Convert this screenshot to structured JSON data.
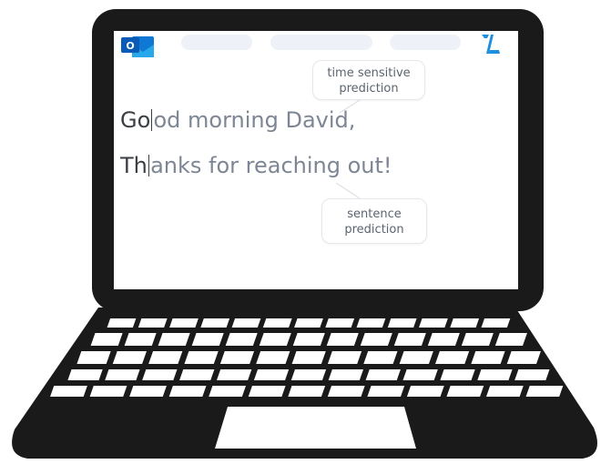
{
  "app": {
    "icon_name": "outlook-icon",
    "icon_letter": "O",
    "brand_logo_name": "typewise-logo-icon",
    "brand_color": "#1d8fdc"
  },
  "toolbar": {
    "pill_count": 3
  },
  "composer": {
    "line1": {
      "typed": "Go",
      "predicted": "od morning David,"
    },
    "line2": {
      "typed": "Th",
      "predicted": "anks for reaching out!"
    }
  },
  "callouts": {
    "time_sensitive": {
      "line1": "time sensitive",
      "line2": "prediction"
    },
    "sentence": {
      "line1": "sentence",
      "line2": "prediction"
    }
  },
  "colors": {
    "typed_text": "#3b3f45",
    "predicted_text": "#7d8694",
    "laptop_body": "#1a1a1a"
  }
}
